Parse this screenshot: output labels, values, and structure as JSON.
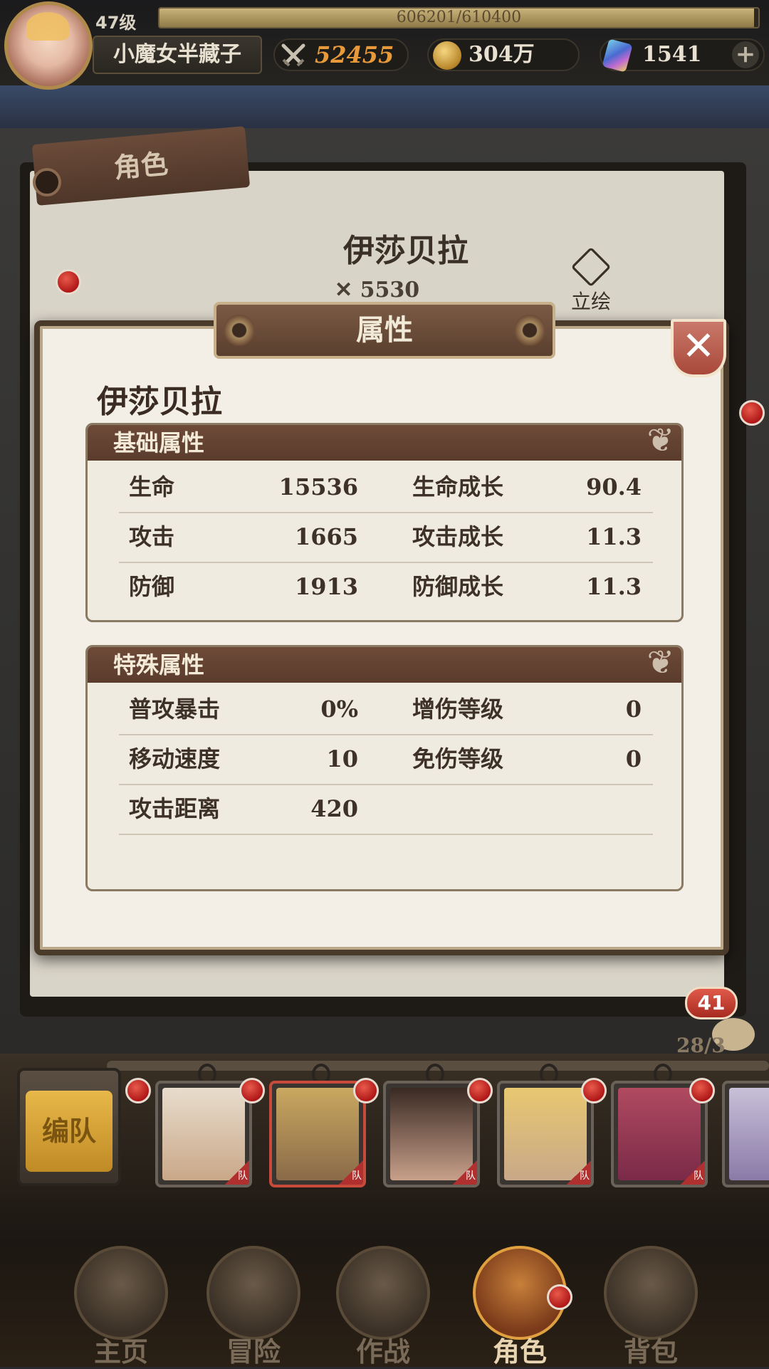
{
  "player": {
    "level": "47级",
    "exp_text": "606201/610400",
    "exp_fraction": 0.993,
    "name": "小魔女半藏子"
  },
  "resources": {
    "power": "52455",
    "gold": "304万",
    "gems": "1541",
    "add_label": "+"
  },
  "background_panel": {
    "tab_label": "角色",
    "character_name": "伊莎贝拉",
    "power": "5530",
    "portrait_label": "立绘"
  },
  "modal": {
    "title": "属性",
    "close_label": "✕",
    "character_name": "伊莎贝拉",
    "basic": {
      "title": "基础属性",
      "rows": [
        {
          "label": "生命",
          "value": "15536",
          "label2": "生命成长",
          "value2": "90.4"
        },
        {
          "label": "攻击",
          "value": "1665",
          "label2": "攻击成长",
          "value2": "11.3"
        },
        {
          "label": "防御",
          "value": "1913",
          "label2": "防御成长",
          "value2": "11.3"
        }
      ]
    },
    "special": {
      "title": "特殊属性",
      "rows": [
        {
          "label": "普攻暴击",
          "value": "0%",
          "label2": "增伤等级",
          "value2": "0"
        },
        {
          "label": "移动速度",
          "value": "10",
          "label2": "免伤等级",
          "value2": "0"
        },
        {
          "label": "攻击距离",
          "value": "420",
          "label2": "",
          "value2": ""
        }
      ]
    }
  },
  "team": {
    "formation_label": "编队",
    "hero_tag": "队",
    "chat_count": "41",
    "hero_count": "28/3"
  },
  "bottom_nav": [
    {
      "label": "主页"
    },
    {
      "label": "冒险"
    },
    {
      "label": "作战"
    },
    {
      "label": "角色"
    },
    {
      "label": "背包"
    }
  ],
  "colors": {
    "accent_brown": "#5a3b2c",
    "badge_red": "#b01818",
    "power_orange": "#e89a3a"
  }
}
